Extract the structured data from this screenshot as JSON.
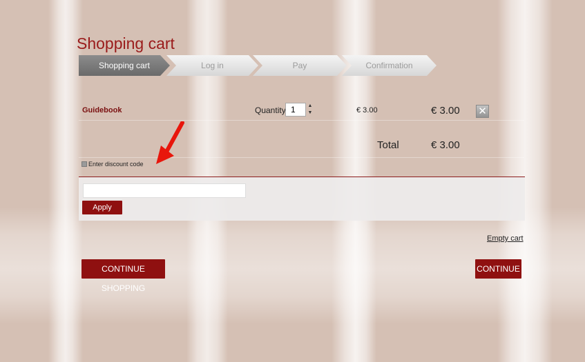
{
  "page": {
    "title": "Shopping cart"
  },
  "steps": [
    {
      "label": "Shopping cart",
      "active": true
    },
    {
      "label": "Log in",
      "active": false
    },
    {
      "label": "Pay",
      "active": false
    },
    {
      "label": "Confirmation",
      "active": false
    }
  ],
  "cart": {
    "items": [
      {
        "name": "Guidebook",
        "quantity_label": "Quantity:",
        "quantity": "1",
        "unit_price": "€ 3.00",
        "line_total": "€ 3.00"
      }
    ],
    "total_label": "Total",
    "total_value": "€ 3.00"
  },
  "discount": {
    "toggle_label": "Enter discount code",
    "input_value": "",
    "apply_label": "Apply"
  },
  "actions": {
    "empty_cart": "Empty cart",
    "continue_shopping": "CONTINUE SHOPPING",
    "continue": "CONTINUE"
  },
  "colors": {
    "brand_red": "#8f1010",
    "title_red": "#9a1b1b",
    "annotation_arrow": "#e8160c"
  }
}
